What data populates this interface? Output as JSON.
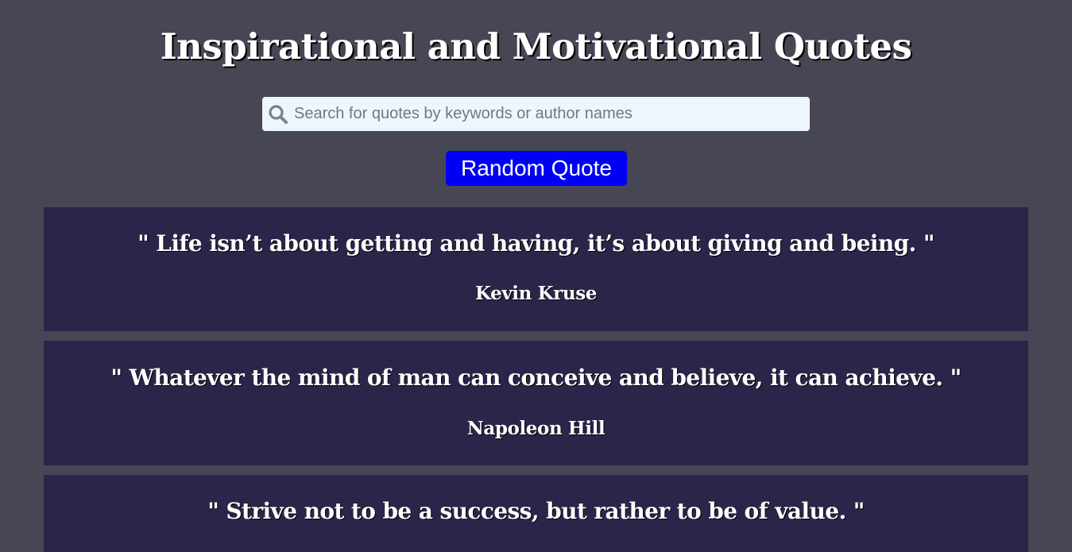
{
  "header": {
    "title": "Inspirational and Motivational Quotes"
  },
  "search": {
    "placeholder": "Search for quotes by keywords or author names",
    "value": "",
    "icon": "search-icon"
  },
  "random_button": {
    "label": "Random Quote"
  },
  "quotes": [
    {
      "text": "\" Life isn’t about getting and having, it’s about giving and being. \"",
      "author": "Kevin Kruse"
    },
    {
      "text": "\" Whatever the mind of man can conceive and believe, it can achieve. \"",
      "author": "Napoleon Hill"
    },
    {
      "text": "\" Strive not to be a success, but rather to be of value. \"",
      "author": ""
    }
  ],
  "colors": {
    "background": "#464655",
    "card": "#29264a",
    "button": "#0000f5",
    "search_background": "#eef6fd",
    "text": "#ffffff"
  }
}
